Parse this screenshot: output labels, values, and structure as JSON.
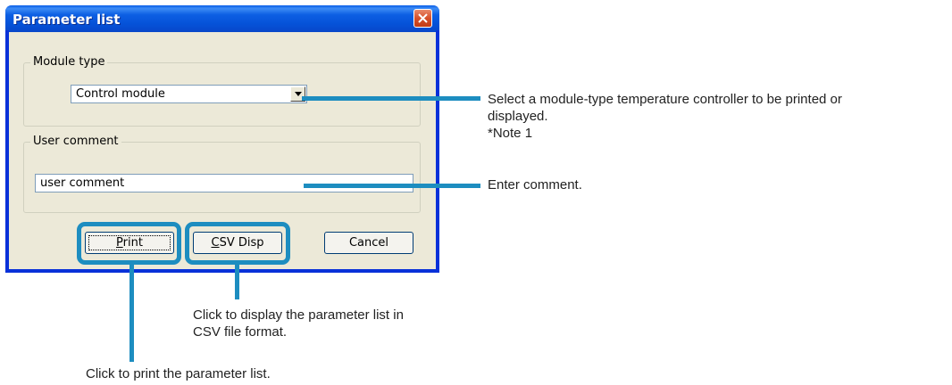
{
  "dialog": {
    "title": "Parameter list",
    "module_group_label": "Module type",
    "module_selected": "Control module",
    "comment_group_label": "User comment",
    "comment_value": "user comment",
    "print_label_first": "P",
    "print_label_rest": "rint",
    "csv_label_first": "C",
    "csv_label_rest": "SV Disp",
    "cancel_label": "Cancel"
  },
  "callouts": {
    "module_line1": "Select a module-type temperature controller to be printed or",
    "module_line2": "displayed.",
    "module_line3": "*Note 1",
    "comment": "Enter comment.",
    "csv_line1": "Click to display the parameter list in",
    "csv_line2": "CSV file format.",
    "print": "Click to print the parameter list."
  },
  "colors": {
    "accent": "#1d8dc0",
    "titlebar": "#0552d8",
    "dialog_bg": "#ece9d8"
  }
}
